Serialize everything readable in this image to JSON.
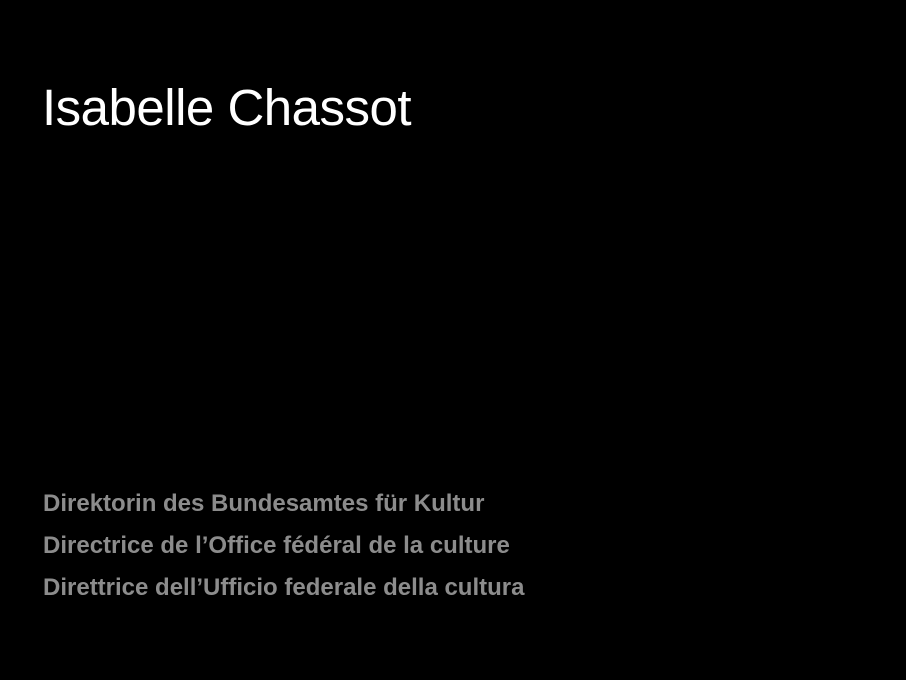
{
  "person": {
    "name": "Isabelle Chassot"
  },
  "titles": [
    "Direktorin des Bundesamtes für Kultur",
    "Directrice de l’Office fédéral de la culture",
    "Direttrice dell’Ufficio federale della cultura"
  ],
  "colors": {
    "background": "#000000",
    "name_text": "#ffffff",
    "title_text": "#8c8c8c"
  }
}
